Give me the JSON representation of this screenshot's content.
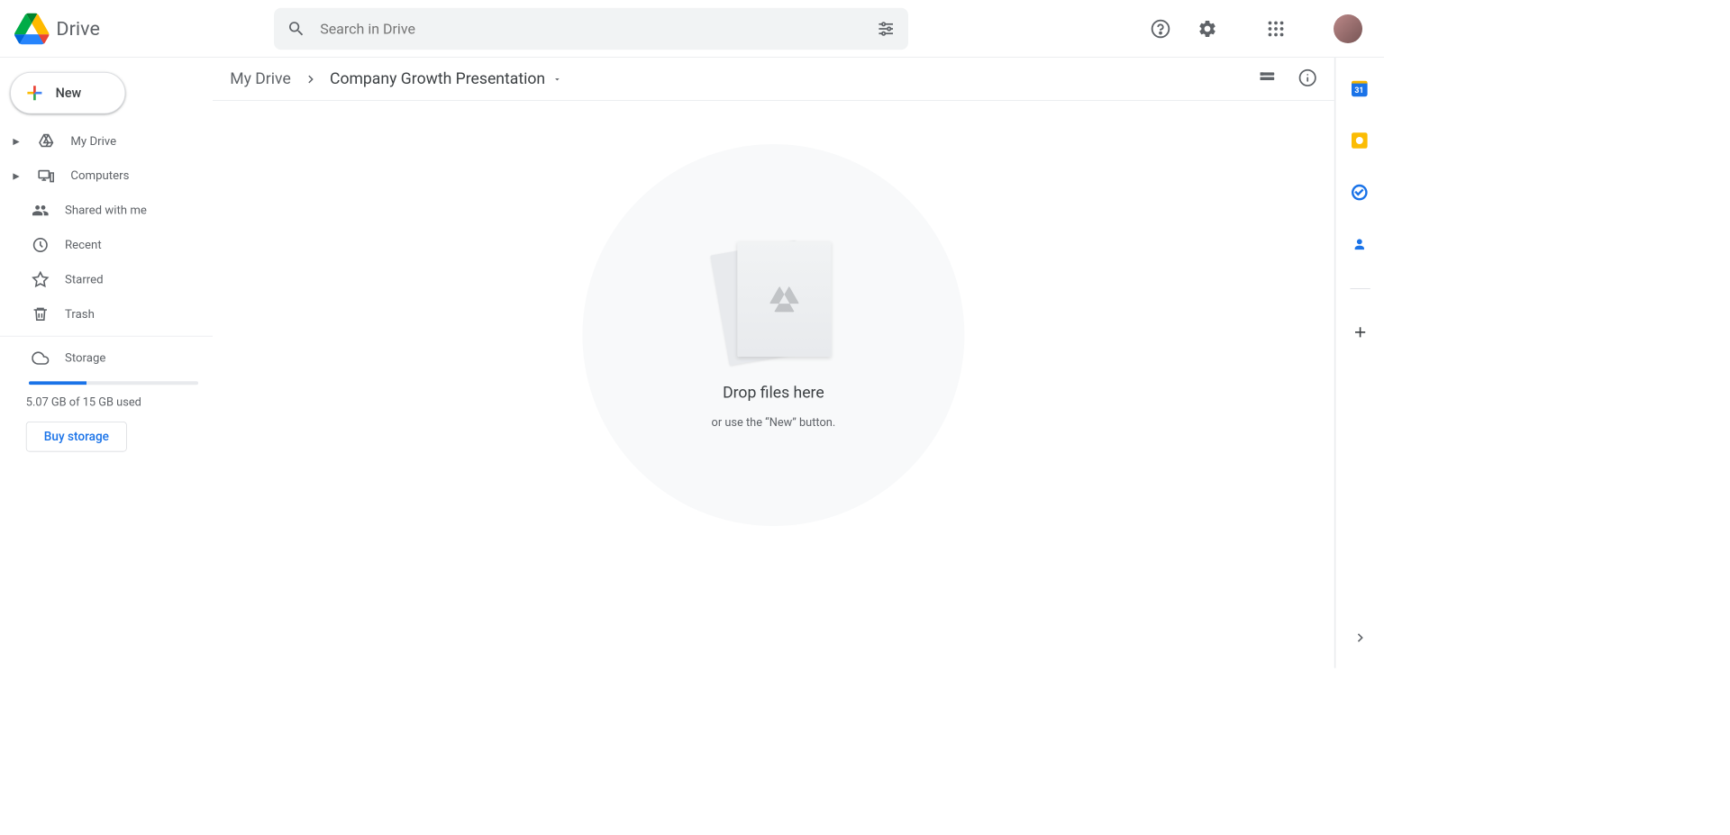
{
  "header": {
    "app_name": "Drive",
    "search_placeholder": "Search in Drive"
  },
  "sidebar": {
    "new_label": "New",
    "items": [
      {
        "label": "My Drive"
      },
      {
        "label": "Computers"
      },
      {
        "label": "Shared with me"
      },
      {
        "label": "Recent"
      },
      {
        "label": "Starred"
      },
      {
        "label": "Trash"
      }
    ],
    "storage_label": "Storage",
    "storage_used_text": "5.07 GB of 15 GB used",
    "storage_used_pct": 34,
    "buy_label": "Buy storage"
  },
  "breadcrumb": {
    "root": "My Drive",
    "current": "Company Growth Presentation"
  },
  "empty_state": {
    "title": "Drop files here",
    "subtitle": "or use the “New” button."
  },
  "sidepanel": {
    "calendar_day": "31"
  }
}
